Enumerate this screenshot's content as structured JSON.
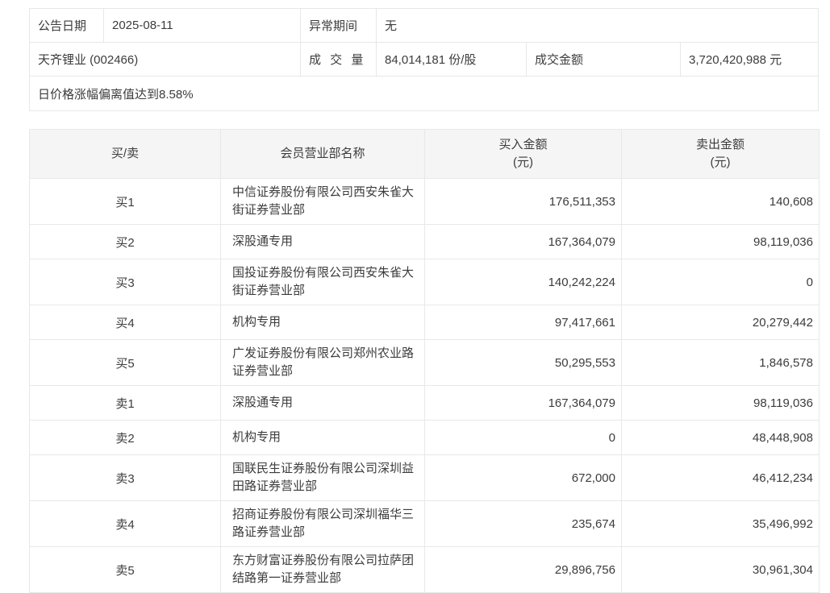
{
  "info": {
    "announce_date_label": "公告日期",
    "announce_date": "2025-08-11",
    "abnormal_period_label": "异常期间",
    "abnormal_period": "无",
    "stock_name": "天齐锂业 (002466)",
    "volume_label": "成 交 量",
    "volume": "84,014,181 份/股",
    "turnover_label": "成交金额",
    "turnover": "3,720,420,988 元",
    "deviation_reason": "日价格涨幅偏离值达到8.58%"
  },
  "table": {
    "headers": {
      "side": "买/卖",
      "branch": "会员营业部名称",
      "buy_line1": "买入金额",
      "buy_line2": "(元)",
      "sell_line1": "卖出金额",
      "sell_line2": "(元)"
    },
    "rows": [
      {
        "side": "买1",
        "branch": "中信证券股份有限公司西安朱雀大街证券营业部",
        "buy": "176,511,353",
        "sell": "140,608"
      },
      {
        "side": "买2",
        "branch": "深股通专用",
        "buy": "167,364,079",
        "sell": "98,119,036"
      },
      {
        "side": "买3",
        "branch": "国投证券股份有限公司西安朱雀大街证券营业部",
        "buy": "140,242,224",
        "sell": "0"
      },
      {
        "side": "买4",
        "branch": "机构专用",
        "buy": "97,417,661",
        "sell": "20,279,442"
      },
      {
        "side": "买5",
        "branch": "广发证券股份有限公司郑州农业路证券营业部",
        "buy": "50,295,553",
        "sell": "1,846,578"
      },
      {
        "side": "卖1",
        "branch": "深股通专用",
        "buy": "167,364,079",
        "sell": "98,119,036"
      },
      {
        "side": "卖2",
        "branch": "机构专用",
        "buy": "0",
        "sell": "48,448,908"
      },
      {
        "side": "卖3",
        "branch": "国联民生证券股份有限公司深圳益田路证券营业部",
        "buy": "672,000",
        "sell": "46,412,234"
      },
      {
        "side": "卖4",
        "branch": "招商证券股份有限公司深圳福华三路证券营业部",
        "buy": "235,674",
        "sell": "35,496,992"
      },
      {
        "side": "卖5",
        "branch": "东方财富证券股份有限公司拉萨团结路第一证券营业部",
        "buy": "29,896,756",
        "sell": "30,961,304"
      }
    ]
  },
  "colors": {
    "border": "#e8e8e8",
    "header_bg": "#f5f5f5",
    "text": "#3c3c3c",
    "background": "#ffffff"
  }
}
